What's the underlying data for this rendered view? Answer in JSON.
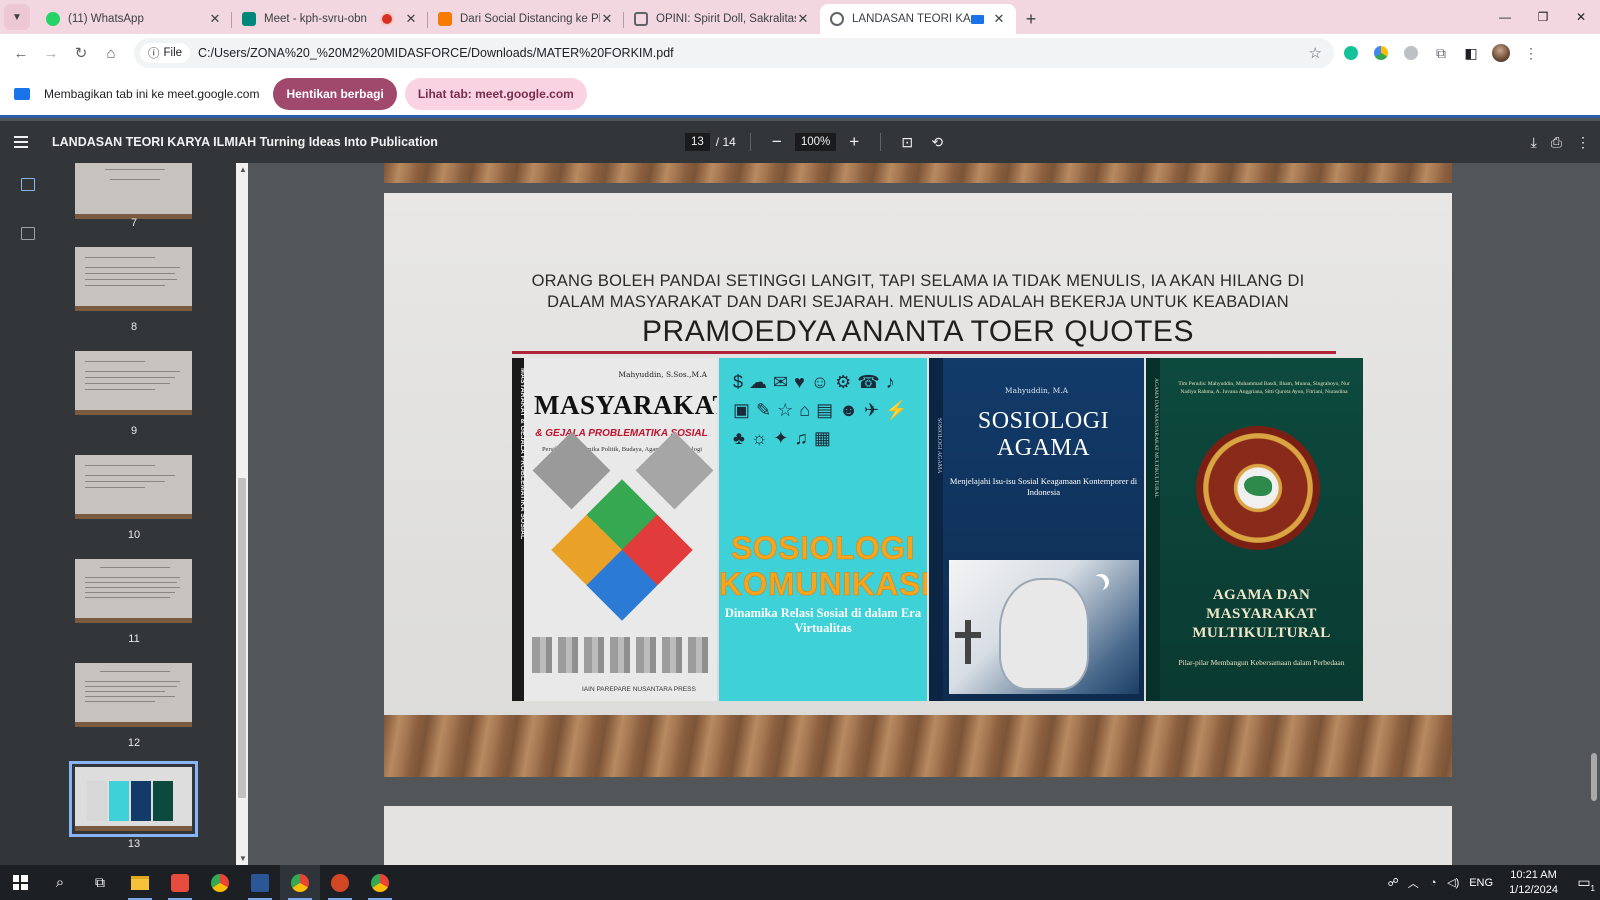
{
  "browser": {
    "tabs": [
      {
        "title": "(11) WhatsApp",
        "icon": "whatsapp-icon",
        "color": "#25d366"
      },
      {
        "title": "Meet - kph-svru-obn",
        "icon": "google-meet-icon",
        "color": "#00897b",
        "recording": true
      },
      {
        "title": "Dari Social Distancing ke Physic",
        "icon": "blogger-icon",
        "color": "#f57c00"
      },
      {
        "title": "OPINI: Spirit Doll, Sakralitas Kel",
        "icon": "lock-icon",
        "color": "#5f6368"
      },
      {
        "title": "LANDASAN TEORI KARYA I",
        "icon": "globe-icon",
        "color": "#5f6368",
        "active": true
      }
    ],
    "address": {
      "chip": "File",
      "url": "C:/Users/ZONA%20_%20M2%20MIDASFORCE/Downloads/MATER%20FORKIM.pdf"
    },
    "sharing": {
      "message": "Membagikan tab ini ke meet.google.com",
      "stop_label": "Hentikan berbagi",
      "view_label": "Lihat tab: meet.google.com"
    }
  },
  "pdf": {
    "title": "LANDASAN TEORI KARYA ILMIAH Turning Ideas Into Publication",
    "current_page": "13",
    "total_pages": "/ 14",
    "zoom": "100%",
    "thumbnails": [
      {
        "label": "7"
      },
      {
        "label": "8"
      },
      {
        "label": "9"
      },
      {
        "label": "10"
      },
      {
        "label": "11"
      },
      {
        "label": "12"
      },
      {
        "label": "13",
        "selected": true
      }
    ],
    "slide": {
      "quote_line1": "ORANG BOLEH PANDAI SETINGGI LANGIT, TAPI SELAMA IA TIDAK MENULIS, IA AKAN HILANG DI",
      "quote_line2": "DALAM MASYARAKAT DAN DARI SEJARAH. MENULIS ADALAH BEKERJA UNTUK KEABADIAN",
      "heading": "PRAMOEDYA ANANTA TOER QUOTES",
      "books": [
        {
          "author": "Mahyuddin, S.Sos.,M.A",
          "title": "MASYARAKAT",
          "subtitle": "& GEJALA PROBLEMATIKA SOSIAL",
          "tagline": "Persilangan Dinamika Politik, Budaya, Agama dan Teknologi",
          "spine": "MASYARAKAT & GEJALA PROBLEMATIKA SOSIAL",
          "publisher": "IAIN PAREPARE NUSANTARA PRESS"
        },
        {
          "title": "SOSIOLOGI KOMUNIKASI",
          "tagline": "Dinamika Relasi Sosial di dalam Era Virtualitas",
          "doodles": "SHARE SOCIAL MEDIA LIKE"
        },
        {
          "author": "Mahyuddin, M.A",
          "title": "SOSIOLOGI AGAMA",
          "tagline": "Menjelajahi Isu-isu Sosial Keagamaan Kontemporer di Indonesia",
          "spine": "SOSIOLOGI AGAMA"
        },
        {
          "authors": "Tim Penulis: Mahyuddin, Muhammad Basdi, Ilham, Munna, Singrahoyo, Nur Nadiya Rahma, A. Juvana Anggriana, Sitti Qurota Ayun, Fitriani, Nurasdina",
          "title": "AGAMA DAN MASYARAKAT MULTIKULTURAL",
          "tagline": "Pilar-pilar Membangun Kebersamaan dalam Perbedaan",
          "spine": "AGAMA DAN MASYARAKAT MULTIKULTURAL"
        }
      ]
    }
  },
  "taskbar": {
    "language": "ENG",
    "time": "10:21 AM",
    "date": "1/12/2024",
    "notification_count": "1"
  }
}
